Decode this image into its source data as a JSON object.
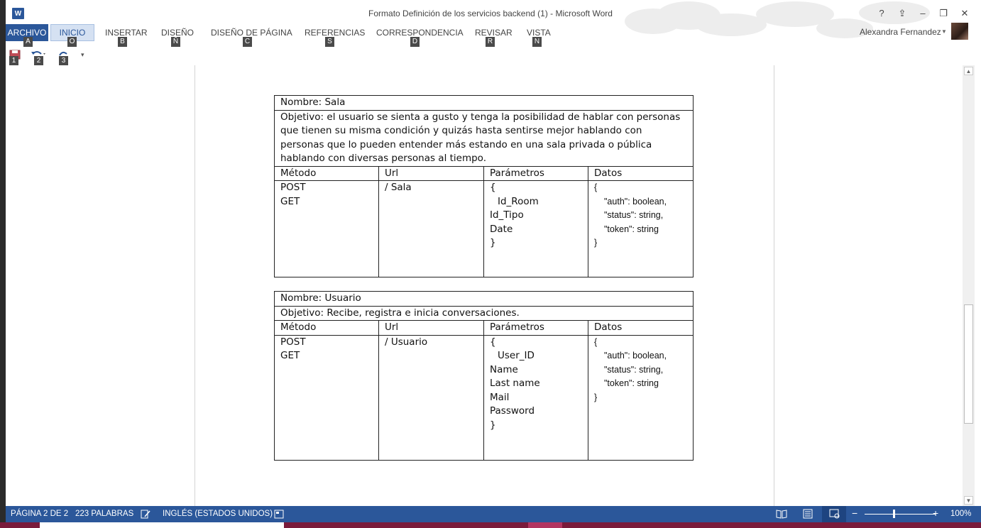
{
  "window": {
    "title": "Formato Definición de los servicios backend (1) - Microsoft Word",
    "logo_letter": "W",
    "help": "?",
    "ribbon_display": "⇪",
    "minimize": "–",
    "restore": "❐",
    "close": "✕"
  },
  "ribbon": {
    "tabs": [
      {
        "label": "ARCHIVO",
        "keytip": "A"
      },
      {
        "label": "INICIO",
        "keytip": "O"
      },
      {
        "label": "INSERTAR",
        "keytip": "B"
      },
      {
        "label": "DISEÑO",
        "keytip": "Ñ"
      },
      {
        "label": "DISEÑO DE PÁGINA",
        "keytip": "C"
      },
      {
        "label": "REFERENCIAS",
        "keytip": "S"
      },
      {
        "label": "CORRESPONDENCIA",
        "keytip": "D"
      },
      {
        "label": "REVISAR",
        "keytip": "R"
      },
      {
        "label": "VISTA",
        "keytip": "N"
      }
    ],
    "user": "Alexandra Fernandez",
    "qat_keytips": [
      "1",
      "2",
      "3"
    ]
  },
  "tables": [
    {
      "nombre": "Nombre: Sala",
      "objetivo": "Objetivo: el usuario se sienta a gusto y tenga la posibilidad de hablar con personas que tienen su misma condición y quizás hasta sentirse mejor hablando con  personas que lo pueden entender más estando en una sala privada o pública hablando con diversas personas al tiempo.",
      "headers": [
        "Método",
        "Url",
        "Parámetros",
        "Datos"
      ],
      "metodos": [
        "POST",
        "GET"
      ],
      "url": "/ Sala",
      "parametros": [
        "{",
        "Id_Room",
        "Id_Tipo",
        "Date",
        "}"
      ],
      "datos": [
        "{",
        "\"auth\": boolean,",
        "\"status\": string,",
        "\"token\": string",
        "}"
      ]
    },
    {
      "nombre": "Nombre: Usuario",
      "objetivo": "Objetivo: Recibe, registra e inicia conversaciones.",
      "headers": [
        "Método",
        "Url",
        "Parámetros",
        "Datos"
      ],
      "metodos": [
        "POST",
        "GET"
      ],
      "url": "/ Usuario",
      "parametros": [
        "{",
        "User_ID",
        "Name",
        "Last name",
        "Mail",
        "Password",
        "}"
      ],
      "datos": [
        "{",
        "\"auth\": boolean,",
        "\"status\": string,",
        "\"token\": string",
        "}"
      ]
    }
  ],
  "statusbar": {
    "page": "PÁGINA 2 DE 2",
    "words": "223 PALABRAS",
    "language": "INGLÉS (ESTADOS UNIDOS)",
    "zoom": "100%"
  },
  "colors": {
    "accent": "#2b579a",
    "taskbar": "#7a1b3b"
  }
}
